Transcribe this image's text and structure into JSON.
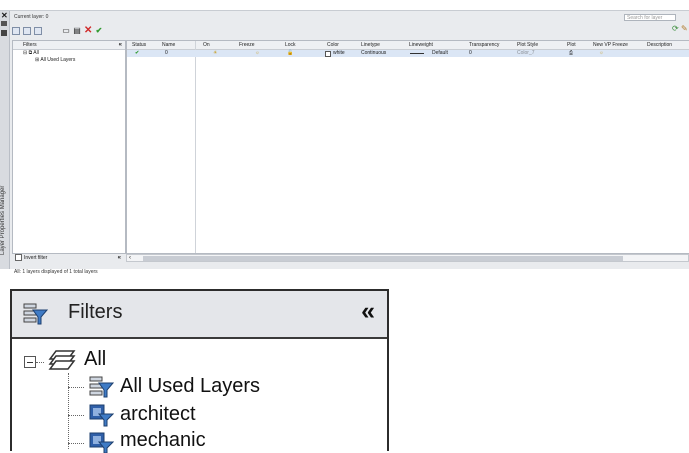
{
  "window": {
    "current_layer": "Current layer: 0",
    "search_placeholder": "Search for layer",
    "side_title": "Layer Properties Manager"
  },
  "filter_panel": {
    "title": "Filters",
    "root": "All",
    "items": [
      "All Used Layers"
    ],
    "invert_filter": "Invert filter"
  },
  "grid": {
    "columns": [
      "Status",
      "Name",
      "On",
      "Freeze",
      "Lock",
      "Color",
      "Linetype",
      "Lineweight",
      "Transparency",
      "Plot Style",
      "Plot",
      "New VP Freeze",
      "Description"
    ],
    "rows": [
      {
        "status": "✔",
        "name": "0",
        "on": "☀",
        "freeze": "☼",
        "lock": "🔓",
        "color_name": "white",
        "linetype": "Continuous",
        "lineweight": "Default",
        "transparency": "0",
        "plot_style": "Color_7",
        "plot": "⎙",
        "new_vp_freeze": "☼",
        "description": ""
      }
    ]
  },
  "status_bar": "All: 1 layers displayed of 1 total layers",
  "zoom_panel": {
    "title": "Filters",
    "root": "All",
    "items": [
      "All Used Layers",
      "architect",
      "mechanic"
    ]
  },
  "colors": {
    "status_green": "#2f9a2f",
    "delete_red": "#d02a2a",
    "selected_row": "#dbe6f5"
  }
}
